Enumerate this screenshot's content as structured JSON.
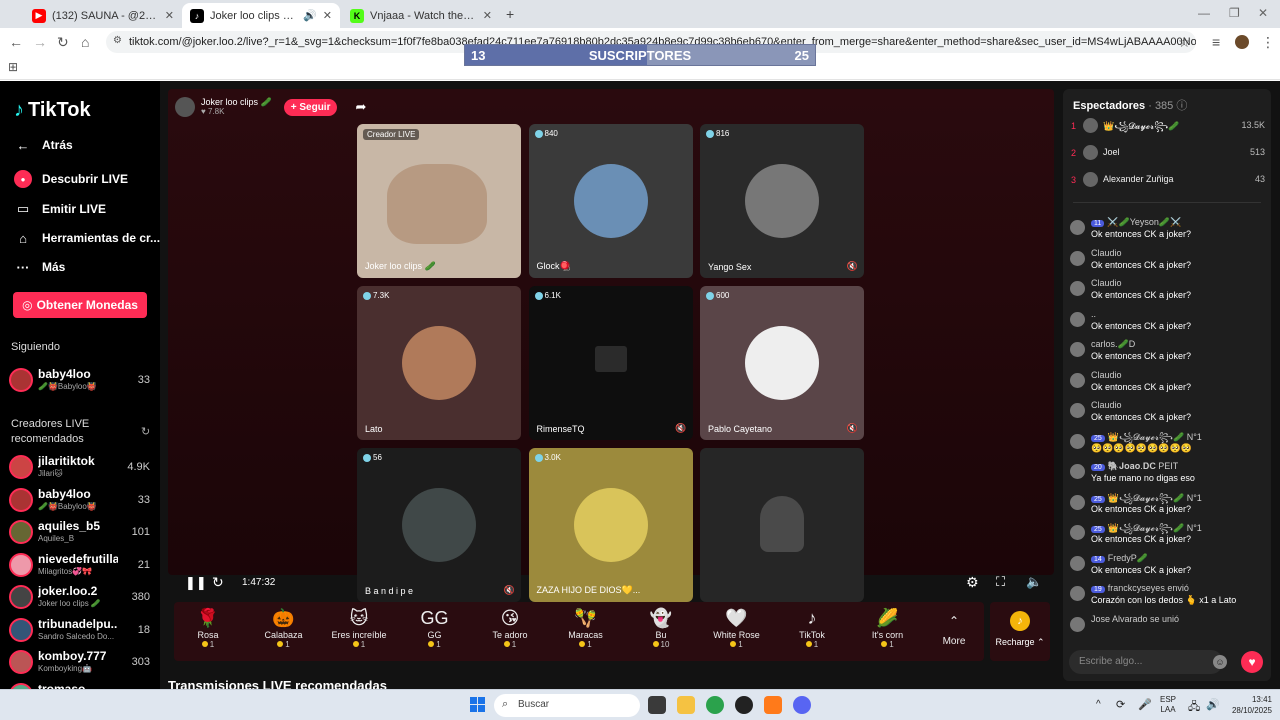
{
  "browser": {
    "tabs": [
      {
        "title": "(132) SAUNA - @26is - YouTube",
        "icon": "youtube-icon",
        "color": "#ff0000"
      },
      {
        "title": "Joker loo clips 🥒 (@joker.l",
        "icon": "tiktok-icon",
        "color": "#000000",
        "active": true
      },
      {
        "title": "Vnjaaa - Watch the VOD on Kick",
        "icon": "kick-icon",
        "color": "#53fc18"
      }
    ],
    "url": "tiktok.com/@joker.loo.2/live?_r=1&_svg=1&checksum=1f0f7fe8ba038efad24c711ee7a76918b80b2dc35a924b8e9c7d99c38b6eb670&enter_from_merge=share&enter_method=share&sec_user_id=MS4wLjABAAAA00NoJFg4ehk1Wa4ShZ2n_Acuqv_tVxR..."
  },
  "subscriber_bar": {
    "left": "13",
    "label": "SUSCRIPTORES",
    "right": "25",
    "progress": 0.52
  },
  "sidebar": {
    "logo": "TikTok",
    "nav": [
      {
        "label": "Atrás",
        "icon": "back-arrow-icon"
      },
      {
        "label": "Descubrir LIVE",
        "icon": "live-icon"
      },
      {
        "label": "Emitir LIVE",
        "icon": "camera-icon"
      },
      {
        "label": "Herramientas de cr...",
        "icon": "home-icon"
      },
      {
        "label": "Más",
        "icon": "more-icon"
      }
    ],
    "coins_label": "Obtener Monedas",
    "following_title": "Siguiendo",
    "following": [
      {
        "name": "baby4loo",
        "sub": "🥒👹Babyloo👹",
        "count": "33"
      }
    ],
    "recommended_title": "Creadores LIVE recomendados",
    "recommended": [
      {
        "name": "jilaritiktok",
        "sub": "Jilari🐱",
        "count": "4.9K"
      },
      {
        "name": "baby4loo",
        "sub": "🥒👹Babyloo👹",
        "count": "33"
      },
      {
        "name": "aquiles_b5",
        "sub": "Aquiles_B",
        "count": "101"
      },
      {
        "name": "nievedefrutilla",
        "sub": "Milagritos💞🎀",
        "count": "21"
      },
      {
        "name": "joker.loo.2",
        "sub": "Joker loo clips 🥒",
        "count": "380"
      },
      {
        "name": "tribunadelpu...",
        "sub": "Sandro Salcedo Do...",
        "count": "18"
      },
      {
        "name": "komboy.777",
        "sub": "Komboyking🤖",
        "count": "303"
      },
      {
        "name": "tromaso",
        "sub": "",
        "count": ""
      }
    ]
  },
  "host": {
    "name": "Joker loo clips 🥒",
    "likes": "7.8K",
    "follow_label": "+ Seguir"
  },
  "grid": [
    {
      "name": "Joker loo clips 🥒",
      "viewers": "",
      "creator_tag": "Creador LIVE",
      "muted": false
    },
    {
      "name": "Glock🪀",
      "viewers": "840",
      "muted": false
    },
    {
      "name": "Yango Sex",
      "viewers": "816",
      "muted": true
    },
    {
      "name": "Lato",
      "viewers": "7.3K",
      "muted": false
    },
    {
      "name": "RimenseTQ",
      "viewers": "6.1K",
      "muted": true
    },
    {
      "name": "Pablo Cayetano",
      "viewers": "600",
      "muted": true
    },
    {
      "name": "B a n d i p e",
      "viewers": "56",
      "muted": true
    },
    {
      "name": "ZAZA HIJO DE DIOS💛...",
      "viewers": "3.0K",
      "muted": false
    },
    {
      "name": "",
      "viewers": "",
      "muted": false
    }
  ],
  "player": {
    "time": "1:47:32"
  },
  "gifts": [
    {
      "name": "Rosa",
      "cost": "1",
      "icon": "🌹"
    },
    {
      "name": "Calabaza",
      "cost": "1",
      "icon": "🎃"
    },
    {
      "name": "Eres increíble",
      "cost": "1",
      "icon": "🐱"
    },
    {
      "name": "GG",
      "cost": "1",
      "icon": "GG"
    },
    {
      "name": "Te adoro",
      "cost": "1",
      "icon": "😘"
    },
    {
      "name": "Maracas",
      "cost": "1",
      "icon": "🪇"
    },
    {
      "name": "Bu",
      "cost": "10",
      "icon": "👻"
    },
    {
      "name": "White Rose",
      "cost": "1",
      "icon": "🤍"
    },
    {
      "name": "TikTok",
      "cost": "1",
      "icon": "♪"
    },
    {
      "name": "It's corn",
      "cost": "1",
      "icon": "🌽"
    }
  ],
  "gift_more": "More",
  "recharge": "Recharge ⌃",
  "recommended_streams_title": "Transmisiones LIVE recomendadas",
  "chat": {
    "title": "Espectadores",
    "count": "· 385",
    "top": [
      {
        "rank": "1",
        "name": "👑꧁𝓓𝓪𝔂𝓮𝓻꧂🥒",
        "score": "13.5K"
      },
      {
        "rank": "2",
        "name": "Joel",
        "score": "513"
      },
      {
        "rank": "3",
        "name": "Alexander Zuñiga",
        "score": "43"
      }
    ],
    "messages": [
      {
        "user": "⚔️🥒Yeyson🥒⚔️",
        "badge": "11",
        "text": "Ok entonces CK a joker?"
      },
      {
        "user": "Claudio",
        "badge": "",
        "text": "Ok entonces CK a joker?"
      },
      {
        "user": "Claudio",
        "badge": "",
        "text": "Ok entonces CK a joker?"
      },
      {
        "user": "..",
        "badge": "",
        "text": "Ok entonces CK a joker?"
      },
      {
        "user": "carlos.🥒D",
        "badge": "",
        "text": "Ok entonces CK a joker?"
      },
      {
        "user": "Claudio",
        "badge": "",
        "text": "Ok entonces CK a joker?"
      },
      {
        "user": "Claudio",
        "badge": "",
        "text": "Ok entonces CK a joker?"
      },
      {
        "user": "👑꧁𝓓𝓪𝔂𝓮𝓻꧂🥒 N°1",
        "badge": "25",
        "text": "🥺🥺🥺🥺🥺🥺🥺🥺🥺"
      },
      {
        "user": "🐘𝐉𝐨𝐚𝐨.𝐃𝐂 PEIT",
        "badge": "20",
        "text": "Ya fue mano no digas eso"
      },
      {
        "user": "👑꧁𝓓𝓪𝔂𝓮𝓻꧂🥒 N°1",
        "badge": "25",
        "text": "Ok entonces CK a joker?"
      },
      {
        "user": "👑꧁𝓓𝓪𝔂𝓮𝓻꧂🥒 N°1",
        "badge": "25",
        "text": "Ok entonces CK a joker?"
      },
      {
        "user": "FredyP🥒",
        "badge": "14",
        "text": "Ok entonces CK a joker?"
      },
      {
        "user": "franckcyseyes envió",
        "badge": "19",
        "text": "Corazón con los dedos 🫰 x1 a Lato"
      },
      {
        "user": "Jose Alvarado  se unió",
        "badge": "",
        "text": ""
      }
    ],
    "input_placeholder": "Escribe algo..."
  },
  "taskbar": {
    "search": "Buscar",
    "lang": "ESP",
    "lang2": "LAA",
    "time": "13:41",
    "date": "28/10/2025"
  }
}
